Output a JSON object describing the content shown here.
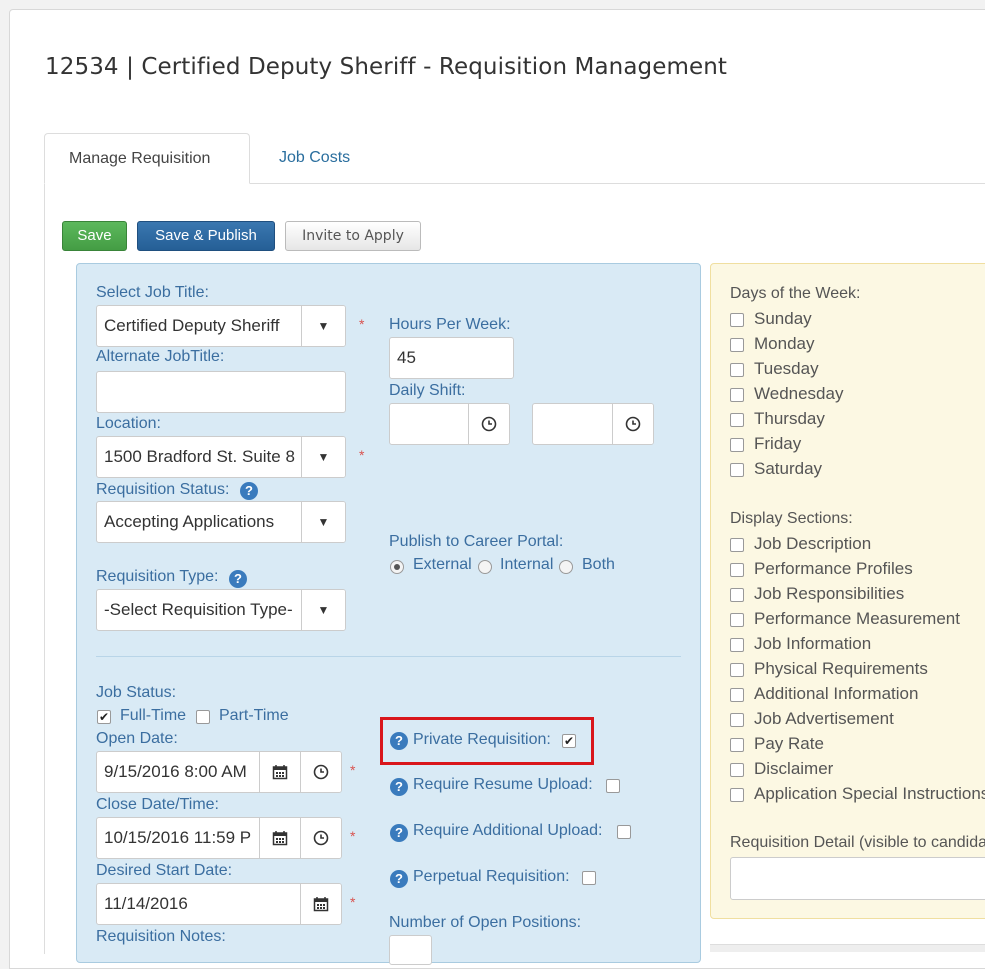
{
  "header": {
    "title": "12534 | Certified Deputy Sheriff - Requisition Management"
  },
  "tabs": [
    {
      "label": "Manage Requisition"
    },
    {
      "label": "Job Costs"
    }
  ],
  "toolbar": {
    "save_label": "Save",
    "publish_label": "Save & Publish",
    "invite_label": "Invite to Apply"
  },
  "form": {
    "job_title_label": "Select Job Title:",
    "job_title_value": "Certified Deputy Sheriff",
    "alt_title_label": "Alternate JobTitle:",
    "alt_title_value": "",
    "location_label": "Location:",
    "location_value": "1500 Bradford St. Suite 8",
    "status_label": "Requisition Status:",
    "status_value": "Accepting Applications",
    "type_label": "Requisition Type:",
    "type_value": "-Select Requisition Type-",
    "hours_label": "Hours Per Week:",
    "hours_value": "45",
    "shift_label": "Daily Shift:",
    "shift_start": "",
    "shift_end": "",
    "portal_label": "Publish to Career Portal:",
    "portal_options": [
      "External",
      "Internal",
      "Both"
    ],
    "portal_selected": "External",
    "job_status_label": "Job Status:",
    "full_time_label": "Full-Time",
    "part_time_label": "Part-Time",
    "full_time_checked": true,
    "part_time_checked": false,
    "open_date_label": "Open Date:",
    "open_date_value": "9/15/2016 8:00 AM",
    "close_date_label": "Close Date/Time:",
    "close_date_value": "10/15/2016 11:59 P",
    "start_date_label": "Desired Start Date:",
    "start_date_value": "11/14/2016",
    "notes_label": "Requisition Notes:",
    "private_label": "Private Requisition:",
    "private_checked": true,
    "resume_label": "Require Resume Upload:",
    "additional_label": "Require Additional Upload:",
    "perpetual_label": "Perpetual Requisition:",
    "open_positions_label": "Number of Open Positions:",
    "required_mark": "*"
  },
  "side": {
    "days_label": "Days of the Week:",
    "days": [
      "Sunday",
      "Monday",
      "Tuesday",
      "Wednesday",
      "Thursday",
      "Friday",
      "Saturday"
    ],
    "sections_label": "Display Sections:",
    "sections": [
      "Job Description",
      "Performance Profiles",
      "Job Responsibilities",
      "Performance Measurement",
      "Job Information",
      "Physical Requirements",
      "Additional Information",
      "Job Advertisement",
      "Pay Rate",
      "Disclaimer",
      "Application Special Instructions"
    ],
    "detail_label": "Requisition Detail (visible to candidates)"
  },
  "colors": {
    "accent": "#2a6e9e",
    "save": "#5cb85c",
    "publish": "#255f96",
    "highlight": "#d9161b"
  }
}
